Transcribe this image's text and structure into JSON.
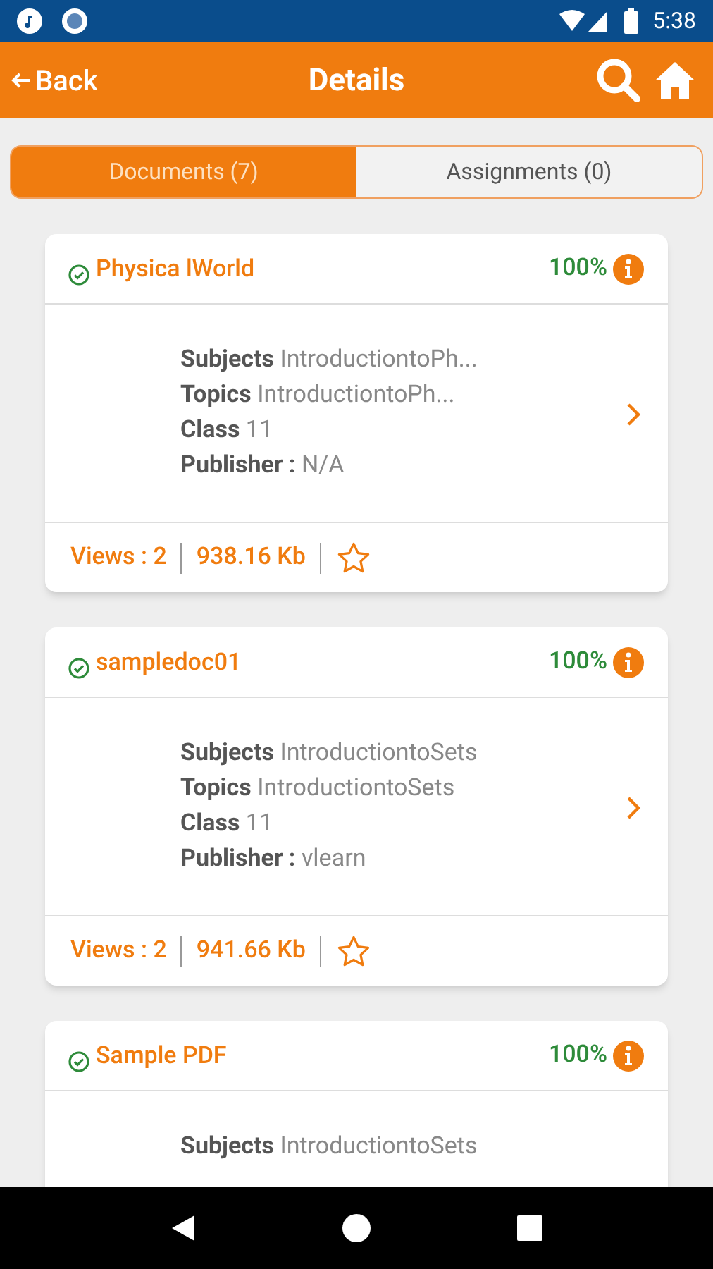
{
  "status_bar": {
    "time": "5:38"
  },
  "header": {
    "back": "Back",
    "title": "Details"
  },
  "tabs": [
    {
      "label": "Documents (7)",
      "selected": true
    },
    {
      "label": "Assignments (0)",
      "selected": false
    }
  ],
  "documents": [
    {
      "title": "Physica lWorld",
      "completed": true,
      "percent": "100%",
      "fields": [
        {
          "label": "Subjects",
          "value": "IntroductiontoPh..."
        },
        {
          "label": "Topics",
          "value": "IntroductiontoPh..."
        },
        {
          "label": "Class",
          "value": "11"
        },
        {
          "label": "Publisher :",
          "value": "N/A"
        }
      ],
      "views": "Views : 2",
      "size": "938.16 Kb",
      "starred": false
    },
    {
      "title": "sampledoc01",
      "completed": true,
      "percent": "100%",
      "fields": [
        {
          "label": "Subjects",
          "value": "IntroductiontoSets"
        },
        {
          "label": "Topics",
          "value": "IntroductiontoSets"
        },
        {
          "label": "Class",
          "value": "11"
        },
        {
          "label": "Publisher :",
          "value": "vlearn"
        }
      ],
      "views": "Views : 2",
      "size": "941.66 Kb",
      "starred": false
    },
    {
      "title": "Sample PDF",
      "completed": true,
      "percent": "100%",
      "fields": [
        {
          "label": "Subjects",
          "value": "IntroductiontoSets"
        }
      ]
    }
  ]
}
